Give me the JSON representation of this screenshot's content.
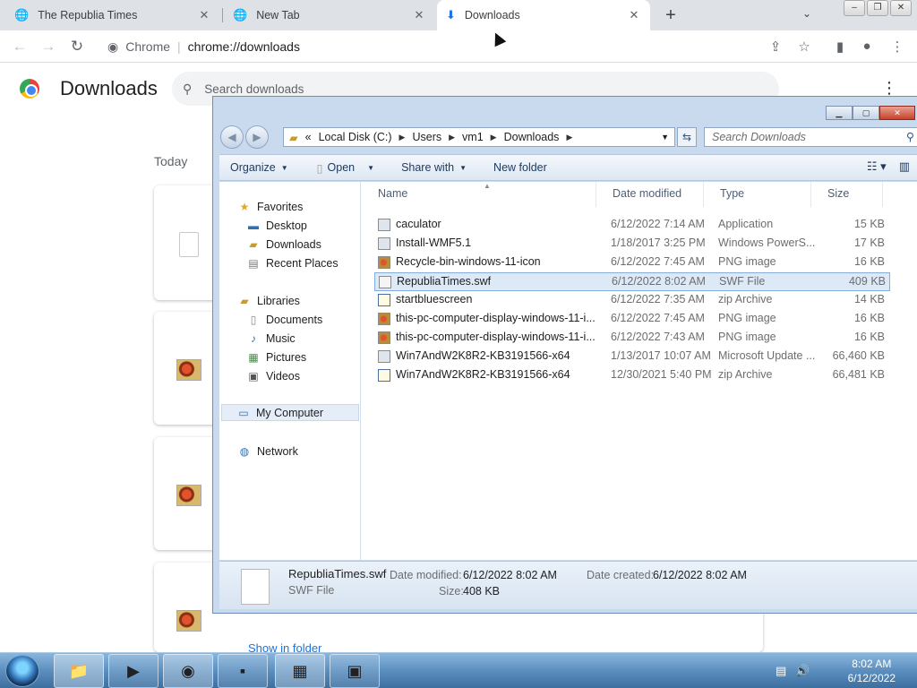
{
  "browser": {
    "tabs": [
      {
        "title": "The Republia Times",
        "active": false
      },
      {
        "title": "New Tab",
        "active": false
      },
      {
        "title": "Downloads",
        "active": true
      }
    ],
    "omnibox": {
      "scheme_label": "Chrome",
      "url": "chrome://downloads"
    }
  },
  "downloads_page": {
    "title": "Downloads",
    "search_placeholder": "Search downloads",
    "section_today": "Today",
    "show_in_folder": "Show in folder"
  },
  "explorer": {
    "breadcrumb": [
      "«",
      "Local Disk (C:)",
      "Users",
      "vm1",
      "Downloads"
    ],
    "search_placeholder": "Search Downloads",
    "commands": {
      "organize": "Organize",
      "open": "Open",
      "share_with": "Share with",
      "new_folder": "New folder"
    },
    "nav": {
      "favorites": "Favorites",
      "desktop": "Desktop",
      "downloads": "Downloads",
      "recent_places": "Recent Places",
      "libraries": "Libraries",
      "documents": "Documents",
      "music": "Music",
      "pictures": "Pictures",
      "videos": "Videos",
      "my_computer": "My Computer",
      "network": "Network"
    },
    "columns": {
      "name": "Name",
      "date": "Date modified",
      "type": "Type",
      "size": "Size"
    },
    "files": [
      {
        "name": "caculator",
        "date": "6/12/2022 7:14 AM",
        "type": "Application",
        "size": "15 KB",
        "icon": "app"
      },
      {
        "name": "Install-WMF5.1",
        "date": "1/18/2017 3:25 PM",
        "type": "Windows PowerS...",
        "size": "17 KB",
        "icon": "app"
      },
      {
        "name": "Recycle-bin-windows-11-icon",
        "date": "6/12/2022 7:45 AM",
        "type": "PNG image",
        "size": "16 KB",
        "icon": "png"
      },
      {
        "name": "RepubliaTimes.swf",
        "date": "6/12/2022 8:02 AM",
        "type": "SWF File",
        "size": "409 KB",
        "icon": "file"
      },
      {
        "name": "startbluescreen",
        "date": "6/12/2022 7:35 AM",
        "type": "zip Archive",
        "size": "14 KB",
        "icon": "zip"
      },
      {
        "name": "this-pc-computer-display-windows-11-i...",
        "date": "6/12/2022 7:45 AM",
        "type": "PNG image",
        "size": "16 KB",
        "icon": "png"
      },
      {
        "name": "this-pc-computer-display-windows-11-i...",
        "date": "6/12/2022 7:43 AM",
        "type": "PNG image",
        "size": "16 KB",
        "icon": "png"
      },
      {
        "name": "Win7AndW2K8R2-KB3191566-x64",
        "date": "1/13/2017 10:07 AM",
        "type": "Microsoft Update ...",
        "size": "66,460 KB",
        "icon": "app"
      },
      {
        "name": "Win7AndW2K8R2-KB3191566-x64",
        "date": "12/30/2021 5:40 PM",
        "type": "zip Archive",
        "size": "66,481 KB",
        "icon": "zip"
      }
    ],
    "details": {
      "name": "RepubliaTimes.swf",
      "type": "SWF File",
      "modified_label": "Date modified:",
      "modified": "6/12/2022 8:02 AM",
      "created_label": "Date created:",
      "created": "6/12/2022 8:02 AM",
      "size_label": "Size:",
      "size": "408 KB"
    }
  },
  "taskbar": {
    "time": "8:02 AM",
    "date": "6/12/2022"
  },
  "colors": {
    "accent": "#1a73e8",
    "selection": "#dde9f7"
  }
}
